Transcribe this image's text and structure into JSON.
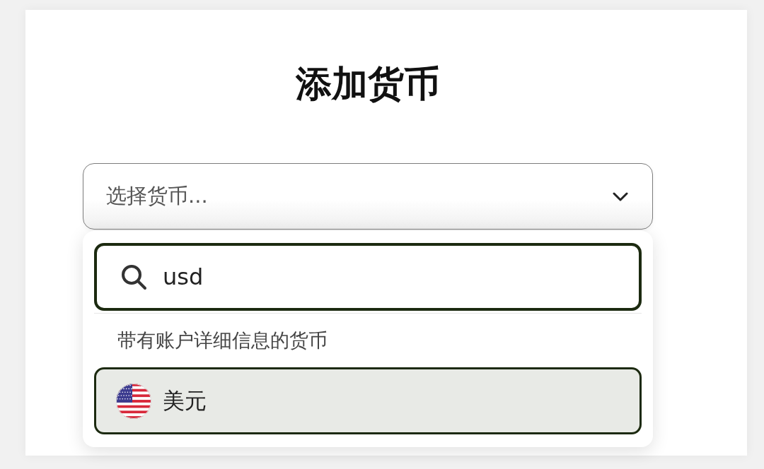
{
  "dialog": {
    "title": "添加货币"
  },
  "select": {
    "placeholder": "选择货币...",
    "expanded": true
  },
  "dropdown": {
    "search": {
      "value": "usd"
    },
    "section_label": "带有账户详细信息的货币",
    "options": [
      {
        "label": "美元",
        "selected": true
      }
    ]
  }
}
